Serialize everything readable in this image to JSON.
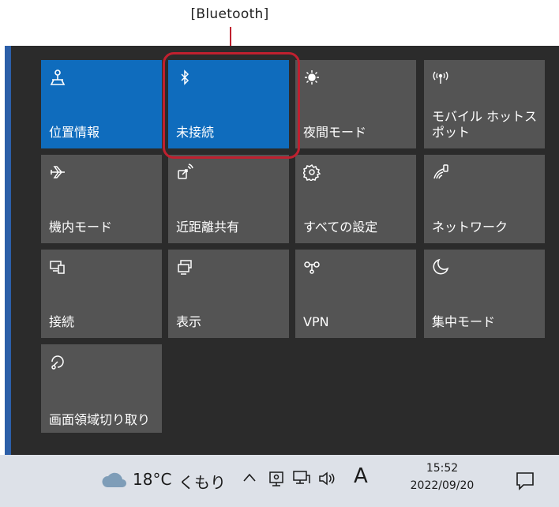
{
  "callout": {
    "label": "[Bluetooth]",
    "color": "#c0202f"
  },
  "tiles": [
    {
      "label": "位置情報",
      "icon": "location-icon",
      "active": true
    },
    {
      "label": "未接続",
      "icon": "bluetooth-icon",
      "active": true
    },
    {
      "label": "夜間モード",
      "icon": "night-light-icon",
      "active": false
    },
    {
      "label": "モバイル ホットスポット",
      "icon": "mobile-hotspot-icon",
      "active": false
    },
    {
      "label": "機内モード",
      "icon": "airplane-icon",
      "active": false
    },
    {
      "label": "近距離共有",
      "icon": "nearby-share-icon",
      "active": false
    },
    {
      "label": "すべての設定",
      "icon": "settings-gear-icon",
      "active": false
    },
    {
      "label": "ネットワーク",
      "icon": "network-icon",
      "active": false
    },
    {
      "label": "接続",
      "icon": "connect-icon",
      "active": false
    },
    {
      "label": "表示",
      "icon": "project-display-icon",
      "active": false
    },
    {
      "label": "VPN",
      "icon": "vpn-icon",
      "active": false
    },
    {
      "label": "集中モード",
      "icon": "focus-moon-icon",
      "active": false
    },
    {
      "label": "画面領域切り取り",
      "icon": "snip-icon",
      "active": false
    }
  ],
  "colors": {
    "active_tile": "#0f6cbd",
    "inactive_tile": "#545454",
    "panel": "#2b2b2b",
    "taskbar": "#dde1e8"
  },
  "taskbar": {
    "weather_temp": "18°C",
    "weather_condition": "くもり",
    "weather_icon": "cloud-icon",
    "ime_label": "A",
    "clock_time": "15:52",
    "clock_date": "2022/09/20"
  }
}
